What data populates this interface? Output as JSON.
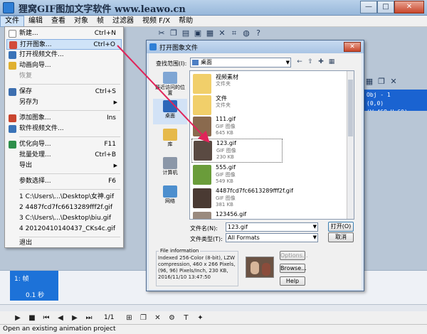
{
  "window": {
    "title": "狸窝GIF图加文字软件 www.leawo.cn",
    "buttons": [
      "—",
      "□",
      "✕"
    ]
  },
  "menubar": [
    "文件",
    "编辑",
    "查看",
    "对象",
    "帧",
    "过滤器",
    "视频 F/X",
    "帮助"
  ],
  "file_menu": {
    "items": [
      {
        "label": "新建...",
        "shortcut": "Ctrl+N"
      },
      {
        "label": "打开图象...",
        "shortcut": "Ctrl+O"
      },
      {
        "label": "打开视频文件...",
        "shortcut": ""
      },
      {
        "label": "动画向导...",
        "shortcut": ""
      },
      {
        "label": "恢复",
        "shortcut": ""
      },
      {
        "label": "保存",
        "shortcut": "Ctrl+S"
      },
      {
        "label": "另存为",
        "shortcut": ""
      },
      {
        "label": "添加图象...",
        "shortcut": "Ins"
      },
      {
        "label": "软件视频文件...",
        "shortcut": ""
      },
      {
        "label": "优化向导...",
        "shortcut": "F11"
      },
      {
        "label": "批量处理...",
        "shortcut": "Ctrl+B"
      },
      {
        "label": "导出",
        "shortcut": ""
      },
      {
        "label": "参数选择...",
        "shortcut": "F6"
      },
      {
        "label": "1 C:\\Users\\...\\Desktop\\女神.gif",
        "shortcut": ""
      },
      {
        "label": "2 4487fcd7fc6613289fff2f.gif",
        "shortcut": ""
      },
      {
        "label": "3 C:\\Users\\...\\Desktop\\biu.gif",
        "shortcut": ""
      },
      {
        "label": "4 20120410140437_CKs4c.gif",
        "shortcut": ""
      },
      {
        "label": "退出",
        "shortcut": ""
      }
    ]
  },
  "object_panel": {
    "line1": "Obj - 1",
    "line2": "(0,0)(W:468,H:60)"
  },
  "frames": {
    "label": "1: 帧",
    "duration": "0.1 秒"
  },
  "playback": {
    "counter": "1/1"
  },
  "status": "Open an existing animation project",
  "dialog": {
    "title": "打开图象文件",
    "close": "✕",
    "look_in_label": "查找范围(I):",
    "look_in_value": "桌面",
    "places": [
      "最近访问的位置",
      "桌面",
      "库",
      "计算机",
      "网络"
    ],
    "files": [
      {
        "name": "视频素材",
        "type": "文件夹",
        "size": ""
      },
      {
        "name": "文件",
        "type": "文件夹",
        "size": ""
      },
      {
        "name": "111.gif",
        "type": "GIF 图像",
        "size": "645 KB"
      },
      {
        "name": "123.gif",
        "type": "GIF 图像",
        "size": "230 KB"
      },
      {
        "name": "555.gif",
        "type": "GIF 图像",
        "size": "549 KB"
      },
      {
        "name": "4487fcd7fc6613289fff2f.gif",
        "type": "GIF 图像",
        "size": "381 KB"
      },
      {
        "name": "123456.gif",
        "type": "",
        "size": ""
      }
    ],
    "filename_label": "文件名(N):",
    "filename_value": "123.gif",
    "filetype_label": "文件类型(T):",
    "filetype_value": "All Formats",
    "open_button": "打开(O)",
    "cancel_button": "取消",
    "info_legend": "File information",
    "info_text": "Indexed 256-Color (8-bit), LZW compression, 460 x 266 Pixels, (96, 96) Pixels/Inch, 230 KB, 2016/11/10 13:47:50",
    "options_button": "Options...",
    "browse_button": "Browse...",
    "help_button": "Help"
  },
  "colors": {
    "accent": "#1a63d1",
    "arrow": "#e0245a"
  }
}
